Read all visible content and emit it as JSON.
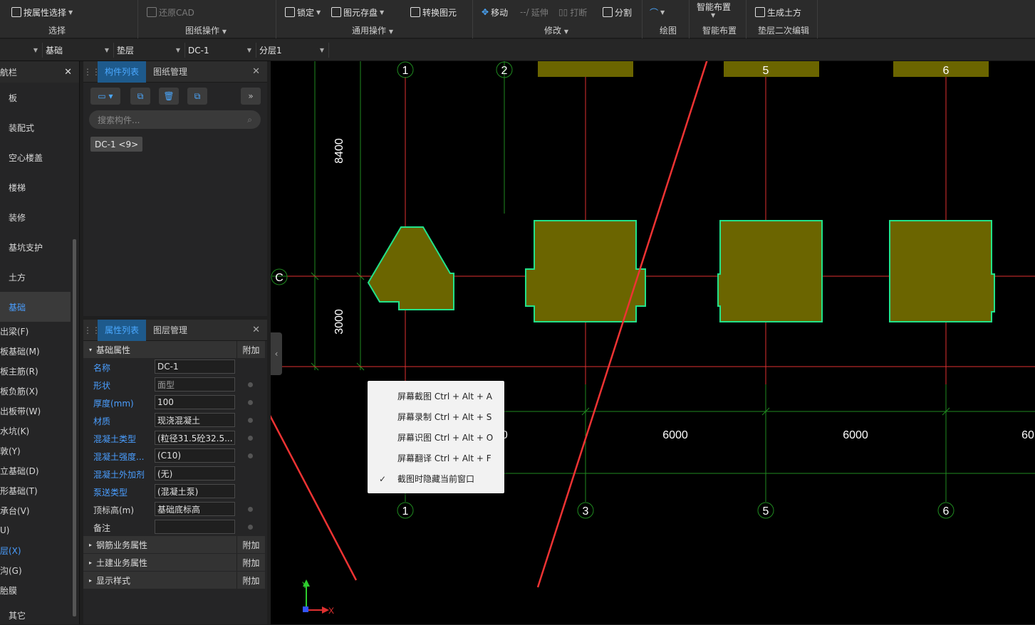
{
  "ribbon": {
    "select_btn": "按属性选择",
    "select_group": "选择",
    "restore_cad": "还原CAD",
    "drawing_ops": "图纸操作",
    "lock": "锁定",
    "save_elem": "图元存盘",
    "convert_elem": "转换图元",
    "general_ops": "通用操作",
    "move": "移动",
    "extend": "延伸",
    "break": "打断",
    "split": "分割",
    "modify": "修改",
    "draw": "绘图",
    "smart_place_btn": "智能布置",
    "smart_place": "智能布置",
    "gen_earth": "生成土方",
    "cushion_edit": "垫层二次编辑"
  },
  "combos": [
    "基础",
    "垫层",
    "DC-1",
    "分层1"
  ],
  "nav": {
    "title": "航栏",
    "items": [
      "板",
      "装配式",
      "空心楼盖",
      "楼梯",
      "装修",
      "基坑支护",
      "土方",
      "基础"
    ],
    "subitems": [
      "出梁(F)",
      "板基础(M)",
      "板主筋(R)",
      "板负筋(X)",
      "出板带(W)",
      "水坑(K)",
      "敦(Y)",
      "立基础(D)",
      "形基础(T)",
      "承台(V)",
      "U)",
      "层(X)",
      "沟(G)",
      "胎膜",
      "其它"
    ]
  },
  "comp_panel": {
    "tab_active": "构件列表",
    "tab_other": "图纸管理",
    "search_placeholder": "搜索构件...",
    "component": "DC-1 <9>"
  },
  "prop_panel": {
    "tab_active": "属性列表",
    "tab_other": "图层管理",
    "section": "基础属性",
    "add": "附加",
    "rows": [
      {
        "label": "名称",
        "value": "DC-1"
      },
      {
        "label": "形状",
        "value": "面型"
      },
      {
        "label": "厚度(mm)",
        "value": "100"
      },
      {
        "label": "材质",
        "value": "现浇混凝土"
      },
      {
        "label": "混凝土类型",
        "value": "(粒径31.5砼32.5..."
      },
      {
        "label": "混凝土强度...",
        "value": "(C10)"
      },
      {
        "label": "混凝土外加剂",
        "value": "(无)"
      },
      {
        "label": "泵送类型",
        "value": "(混凝土泵)"
      },
      {
        "label": "顶标高(m)",
        "value": "基础底标高"
      },
      {
        "label": "备注",
        "value": ""
      }
    ],
    "sections": [
      "钢筋业务属性",
      "土建业务属性",
      "显示样式"
    ]
  },
  "canvas": {
    "axis_top": [
      "1",
      "2",
      "5",
      "6"
    ],
    "axis_bottom": [
      "1",
      "3",
      "5",
      "6"
    ],
    "axis_left": "C",
    "dim_vertical": [
      "8400",
      "3000"
    ],
    "dim_horizontal": [
      "6000",
      "6000",
      "6000",
      "6000",
      "60"
    ],
    "xaxis": "X",
    "yaxis": "Y"
  },
  "context_menu": [
    "屏幕截图 Ctrl + Alt + A",
    "屏幕录制 Ctrl + Alt + S",
    "屏幕识图 Ctrl + Alt + O",
    "屏幕翻译 Ctrl + Alt + F",
    "截图时隐藏当前窗口"
  ],
  "colors": {
    "accent": "#4a9eff",
    "foundation_fill": "#6b6500",
    "foundation_edge": "#22e38a",
    "axis_red": "#e03030",
    "axis_green": "#1f8a1f",
    "arrow": "#ee3333"
  }
}
